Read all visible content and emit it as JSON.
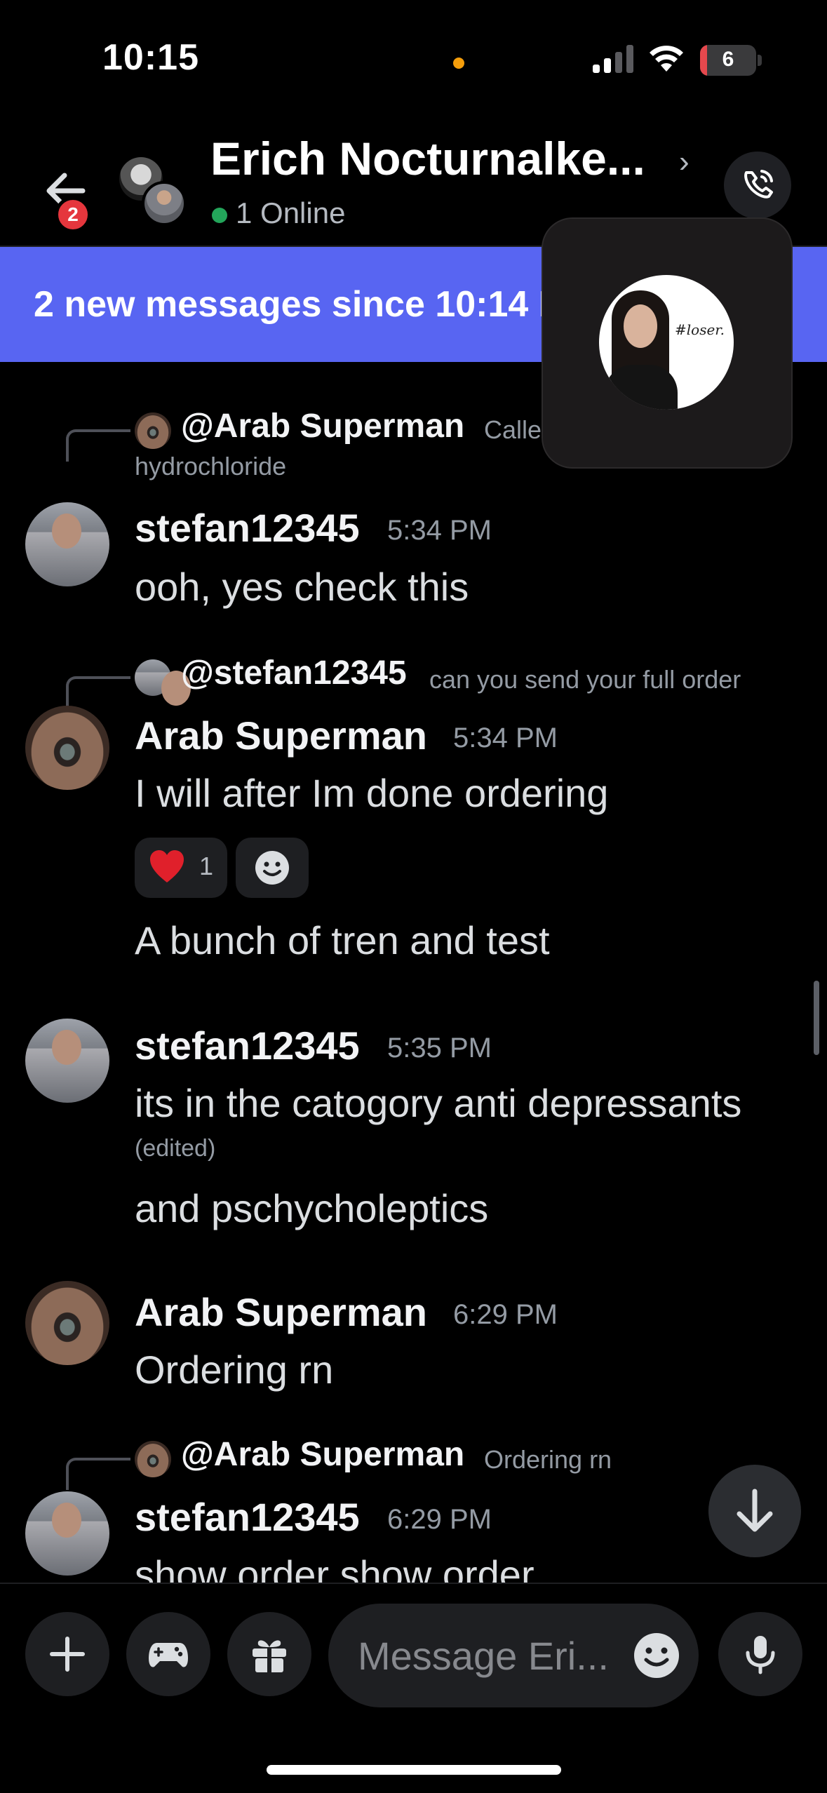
{
  "status_bar": {
    "time": "10:15",
    "battery": "6",
    "battery_color": "#e5484d",
    "icons": [
      "orange-dot-indicator",
      "cellular-signal-icon",
      "wifi-icon",
      "battery-icon"
    ]
  },
  "header": {
    "back_badge": "2",
    "title": "Erich Nocturnalke...",
    "online_text": "1 Online",
    "online_color": "#23a55a",
    "icons": [
      "back-arrow-icon",
      "chevron-right-icon",
      "phone-call-icon"
    ]
  },
  "banner": {
    "text": "2 new messages since 10:14 P",
    "color": "#5865f2"
  },
  "pip": {
    "tag": "#loser."
  },
  "messages": [
    {
      "reply": {
        "name": "@Arab Superman",
        "snippet": "Calle",
        "snippet_wrap": "hydrochloride"
      },
      "author": "stefan12345",
      "time": "5:34 PM",
      "lines": [
        "ooh, yes check this"
      ]
    },
    {
      "reply": {
        "name": "@stefan12345",
        "snippet": "can you send your full order"
      },
      "author": "Arab Superman",
      "time": "5:34 PM",
      "lines": [
        "I will after Im done ordering",
        "A bunch of tren and test"
      ],
      "reactions": [
        {
          "emoji": "heart",
          "count": "1"
        },
        {
          "emoji": "add-reaction"
        }
      ]
    },
    {
      "author": "stefan12345",
      "time": "5:35 PM",
      "lines": [
        "its in the catogory anti depressants",
        "and pschycholeptics"
      ],
      "edited": "(edited)"
    },
    {
      "author": "Arab Superman",
      "time": "6:29 PM",
      "lines": [
        "Ordering rn"
      ]
    },
    {
      "reply": {
        "name": "@Arab Superman",
        "snippet": "Ordering rn"
      },
      "author": "stefan12345",
      "time": "6:29 PM",
      "lines": [
        "show order show order"
      ]
    }
  ],
  "composer": {
    "placeholder": "Message Eri...",
    "buttons": [
      "plus-icon",
      "gamepad-icon",
      "gift-icon",
      "microphone-icon"
    ]
  }
}
